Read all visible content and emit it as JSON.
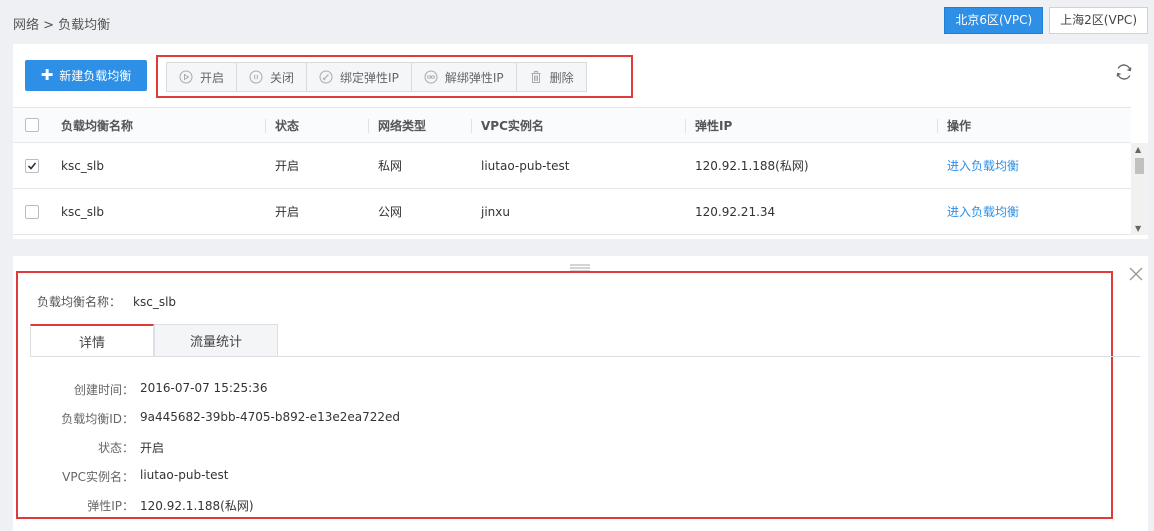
{
  "breadcrumb": "网络 > 负载均衡",
  "regions": [
    {
      "label": "北京6区(VPC)",
      "active": true
    },
    {
      "label": "上海2区(VPC)",
      "active": false
    }
  ],
  "create_label": "新建负载均衡",
  "toolbar": {
    "start": "开启",
    "stop": "关闭",
    "bind_eip": "绑定弹性IP",
    "unbind_eip": "解绑弹性IP",
    "delete": "删除"
  },
  "table": {
    "headers": {
      "name": "负载均衡名称",
      "status": "状态",
      "net_type": "网络类型",
      "vpc": "VPC实例名",
      "eip": "弹性IP",
      "action": "操作"
    },
    "rows": [
      {
        "checked": true,
        "name": "ksc_slb",
        "status": "开启",
        "net_type": "私网",
        "vpc": "liutao-pub-test",
        "eip": "120.92.1.188(私网)",
        "action": "进入负载均衡"
      },
      {
        "checked": false,
        "name": "ksc_slb",
        "status": "开启",
        "net_type": "公网",
        "vpc": "jinxu",
        "eip": "120.92.21.34",
        "action": "进入负载均衡"
      }
    ]
  },
  "detail": {
    "name_label": "负载均衡名称：",
    "name_value": "ksc_slb",
    "tabs": [
      "详情",
      "流量统计"
    ],
    "fields": [
      {
        "label": "创建时间：",
        "value": "2016-07-07 15:25:36"
      },
      {
        "label": "负载均衡ID：",
        "value": "9a445682-39bb-4705-b892-e13e2ea722ed"
      },
      {
        "label": "状态：",
        "value": "开启"
      },
      {
        "label": "VPC实例名：",
        "value": "liutao-pub-test"
      },
      {
        "label": "弹性IP：",
        "value": "120.92.1.188(私网)"
      }
    ]
  },
  "colors": {
    "accent": "#2d8fe5",
    "highlight": "#e03a3a"
  },
  "icons": [
    "plus-icon",
    "play-icon",
    "pause-icon",
    "link-icon",
    "unlink-icon",
    "trash-icon",
    "refresh-icon",
    "check-icon",
    "drag-handle-icon",
    "close-icon"
  ]
}
